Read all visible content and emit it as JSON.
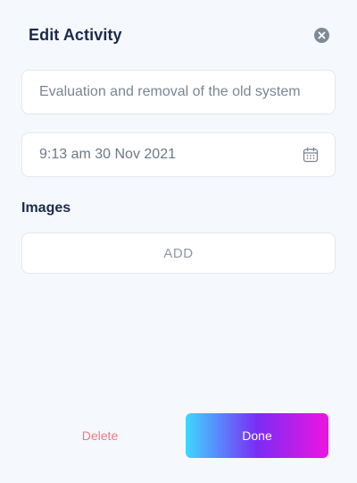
{
  "dialog": {
    "title": "Edit Activity",
    "close_icon": "close-icon"
  },
  "form": {
    "activity_name": "Evaluation and removal of the old system",
    "datetime": "9:13 am 30 Nov 2021",
    "calendar_icon": "calendar-icon"
  },
  "images": {
    "label": "Images",
    "add_label": "ADD"
  },
  "actions": {
    "delete_label": "Delete",
    "done_label": "Done"
  },
  "colors": {
    "title": "#1b2a4a",
    "delete": "#f07a86",
    "done_gradient": [
      "#3fd7ff",
      "#7a2cf5",
      "#ee14e0"
    ]
  }
}
